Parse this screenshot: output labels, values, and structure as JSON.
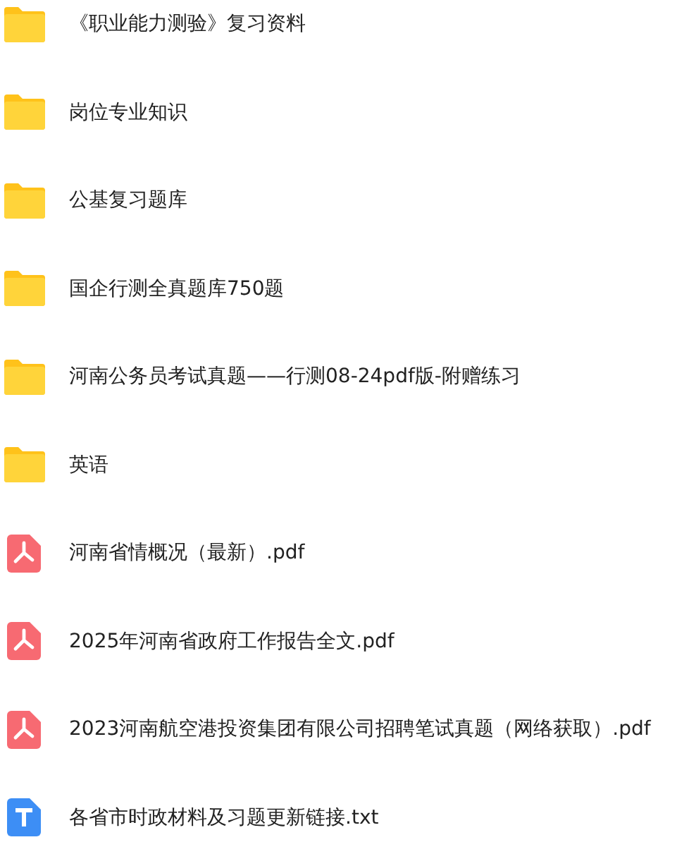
{
  "files": [
    {
      "kind": "folder",
      "name": "《职业能力测验》复习资料"
    },
    {
      "kind": "folder",
      "name": "岗位专业知识"
    },
    {
      "kind": "folder",
      "name": "公基复习题库"
    },
    {
      "kind": "folder",
      "name": "国企行测全真题库750题"
    },
    {
      "kind": "folder",
      "name": "河南公务员考试真题——行测08-24pdf版-附赠练习"
    },
    {
      "kind": "folder",
      "name": "英语"
    },
    {
      "kind": "pdf",
      "name": "河南省情概况（最新）.pdf"
    },
    {
      "kind": "pdf",
      "name": "2025年河南省政府工作报告全文.pdf"
    },
    {
      "kind": "pdf",
      "name": "2023河南航空港投资集团有限公司招聘笔试真题（网络获取）.pdf"
    },
    {
      "kind": "txt",
      "name": "各省市时政材料及习题更新链接.txt"
    }
  ]
}
